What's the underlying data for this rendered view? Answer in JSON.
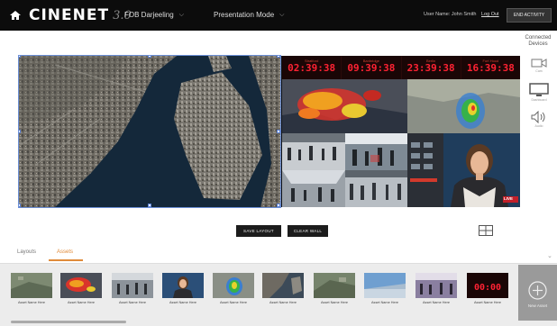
{
  "header": {
    "brand": "CINENET",
    "version": "3.0",
    "location_menu": "FOB Darjeeling",
    "mode_menu": "Presentation Mode",
    "user": "User Name: John Smith",
    "logout": "Log Out",
    "end_activity": "END ACTIVITY",
    "icons": {
      "home": "home-icon",
      "chevron": "chevron-down-icon"
    }
  },
  "devices": {
    "title": "Connected Devices",
    "items": [
      {
        "label": "Cam",
        "icon": "camera-icon"
      },
      {
        "label": "Dashboard",
        "icon": "monitor-icon"
      },
      {
        "label": "Audio",
        "icon": "speaker-icon"
      }
    ]
  },
  "wall": {
    "clocks": [
      {
        "city": "Stratford",
        "time": "02:39:38"
      },
      {
        "city": "Banbridge",
        "time": "09:39:38"
      },
      {
        "city": "Berlin",
        "time": "23:39:38"
      },
      {
        "city": "Fort Hood",
        "time": "16:39:38"
      }
    ],
    "live_badge": "LIVE"
  },
  "actions": {
    "save_layout": "SAVE LAYOUT",
    "clear_wall": "CLEAR WALL",
    "grid_icon": "grid-layout-icon"
  },
  "tabs": [
    {
      "label": "Layouts",
      "active": false
    },
    {
      "label": "Assets",
      "active": true
    }
  ],
  "assets": [
    {
      "name": "Asset Name Here",
      "kind": "satellite"
    },
    {
      "name": "Asset Name Here",
      "kind": "heatmap"
    },
    {
      "name": "Asset Name Here",
      "kind": "crowd"
    },
    {
      "name": "Asset Name Here",
      "kind": "anchor"
    },
    {
      "name": "Asset Name Here",
      "kind": "radar"
    },
    {
      "name": "Asset Name Here",
      "kind": "city"
    },
    {
      "name": "Asset Name Here",
      "kind": "satellite"
    },
    {
      "name": "Asset Name Here",
      "kind": "sky"
    },
    {
      "name": "Asset Name Here",
      "kind": "crowd2"
    },
    {
      "name": "Asset Name Here",
      "kind": "clock"
    }
  ],
  "new_asset": {
    "label": "New Asset",
    "icon": "plus-circle-icon"
  },
  "colors": {
    "accent": "#e08b3a",
    "selection": "#6b8fd6",
    "clock_red": "#ff2233"
  }
}
